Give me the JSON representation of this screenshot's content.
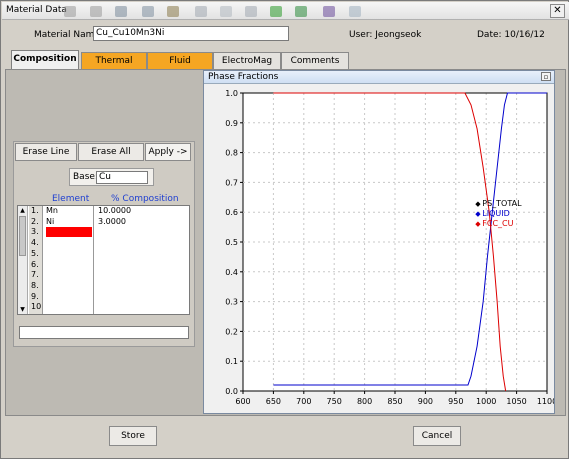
{
  "window": {
    "title": "Material Data",
    "close_glyph": "✕"
  },
  "toolbar": {
    "icons": [
      {
        "name": "back-icon",
        "color": "#9a9a9a"
      },
      {
        "name": "forward-icon",
        "color": "#9a9a9a"
      },
      {
        "name": "cross-icon",
        "color": "#7a8a9a"
      },
      {
        "name": "move-icon",
        "color": "#8090a0"
      },
      {
        "name": "image-icon",
        "color": "#8a7a4a"
      },
      {
        "name": "undo-icon",
        "color": "#a0a8b0"
      },
      {
        "name": "copy-icon",
        "color": "#b0b8c0"
      },
      {
        "name": "paste-icon",
        "color": "#a0a8b0"
      },
      {
        "name": "green-box-icon",
        "color": "#2a9a2a"
      },
      {
        "name": "green-box-2-icon",
        "color": "#2a8a3a"
      },
      {
        "name": "purple-icon",
        "color": "#6a4a9a"
      },
      {
        "name": "check-icon",
        "color": "#a0b0c0"
      }
    ]
  },
  "header": {
    "material_name_label": "Material Name:",
    "material_name_value": "Cu_Cu10Mn3Ni",
    "user": "User:  Jeongseok",
    "date": "Date:  10/16/12"
  },
  "tabs": [
    {
      "label": "Composition",
      "state": "active"
    },
    {
      "label": "Thermal",
      "state": "orange"
    },
    {
      "label": "Fluid",
      "state": "orange"
    },
    {
      "label": "ElectroMag",
      "state": "grey"
    },
    {
      "label": "Comments",
      "state": "grey"
    }
  ],
  "composition": {
    "erase_line": "Erase Line",
    "erase_all": "Erase All",
    "apply": "Apply ->",
    "base_label": "Base:",
    "base_value": "Cu",
    "element_header": "Element",
    "percent_header": "% Composition",
    "rows": [
      {
        "num": "1.",
        "element": "Mn",
        "percent": "10.0000"
      },
      {
        "num": "2.",
        "element": "Ni",
        "percent": "3.0000"
      },
      {
        "num": "3.",
        "element": "",
        "percent": ""
      },
      {
        "num": "4.",
        "element": "",
        "percent": ""
      },
      {
        "num": "5.",
        "element": "",
        "percent": ""
      },
      {
        "num": "6.",
        "element": "",
        "percent": ""
      },
      {
        "num": "7.",
        "element": "",
        "percent": ""
      },
      {
        "num": "8.",
        "element": "",
        "percent": ""
      },
      {
        "num": "9.",
        "element": "",
        "percent": ""
      },
      {
        "num": "10",
        "element": "",
        "percent": ""
      }
    ],
    "selected_row_color": "#ff0000"
  },
  "phase_window": {
    "title": "Phase Fractions"
  },
  "chart_data": {
    "type": "line",
    "xlim": [
      600,
      1100
    ],
    "ylim": [
      0.0,
      1.0
    ],
    "xticks": [
      "600",
      "650",
      "700",
      "750",
      "800",
      "850",
      "900",
      "950",
      "1000",
      "1050",
      "1100"
    ],
    "yticks": [
      "0.0",
      "0.1",
      "0.2",
      "0.3",
      "0.4",
      "0.5",
      "0.6",
      "0.7",
      "0.8",
      "0.9",
      "1.0"
    ],
    "grid": true,
    "legend_position": "center-right",
    "series": [
      {
        "name": "PS_TOTAL",
        "color": "#000000",
        "marker": "◆",
        "x": [
          650,
          1100
        ],
        "y": [
          1.0,
          1.0
        ]
      },
      {
        "name": "LIQUID",
        "color": "#0000cc",
        "marker": "◆",
        "x": [
          650,
          970,
          975,
          985,
          995,
          1002,
          1010,
          1018,
          1025,
          1030,
          1035,
          1100
        ],
        "y": [
          0.02,
          0.02,
          0.05,
          0.15,
          0.3,
          0.45,
          0.6,
          0.75,
          0.88,
          0.96,
          1.0,
          1.0
        ]
      },
      {
        "name": "FCC_CU",
        "color": "#dd0000",
        "marker": "◆",
        "x": [
          650,
          965,
          975,
          985,
          995,
          1005,
          1012,
          1018,
          1023,
          1028,
          1032
        ],
        "y": [
          1.0,
          1.0,
          0.96,
          0.88,
          0.75,
          0.6,
          0.45,
          0.3,
          0.15,
          0.05,
          0.0
        ]
      }
    ]
  },
  "footer": {
    "store": "Store",
    "cancel": "Cancel"
  }
}
